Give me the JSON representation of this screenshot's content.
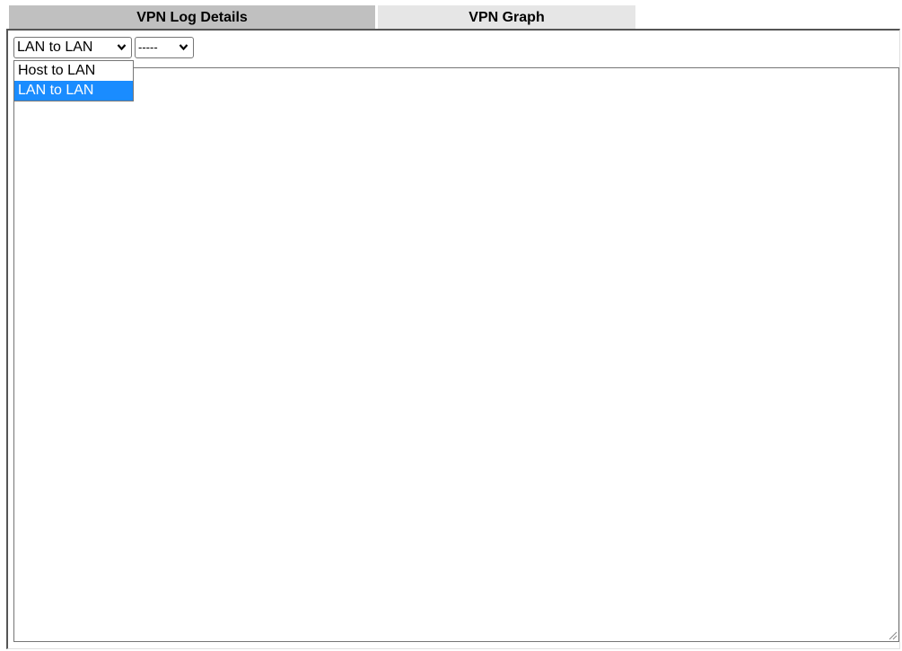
{
  "tabs": [
    {
      "label": "VPN Log Details",
      "active": true
    },
    {
      "label": "VPN Graph",
      "active": false
    }
  ],
  "filters": {
    "type_select": {
      "value": "LAN to LAN",
      "options": [
        "Host to LAN",
        "LAN to LAN"
      ],
      "open": true
    },
    "profile_select": {
      "value": "-----"
    }
  },
  "log": {
    "content": ""
  },
  "colors": {
    "active_tab": "#c0c0c0",
    "inactive_tab": "#e6e6e6",
    "selected_option": "#1a8cff"
  },
  "icons": {
    "select_arrow": "chevron-down-icon",
    "resize": "resize-grip-icon"
  }
}
